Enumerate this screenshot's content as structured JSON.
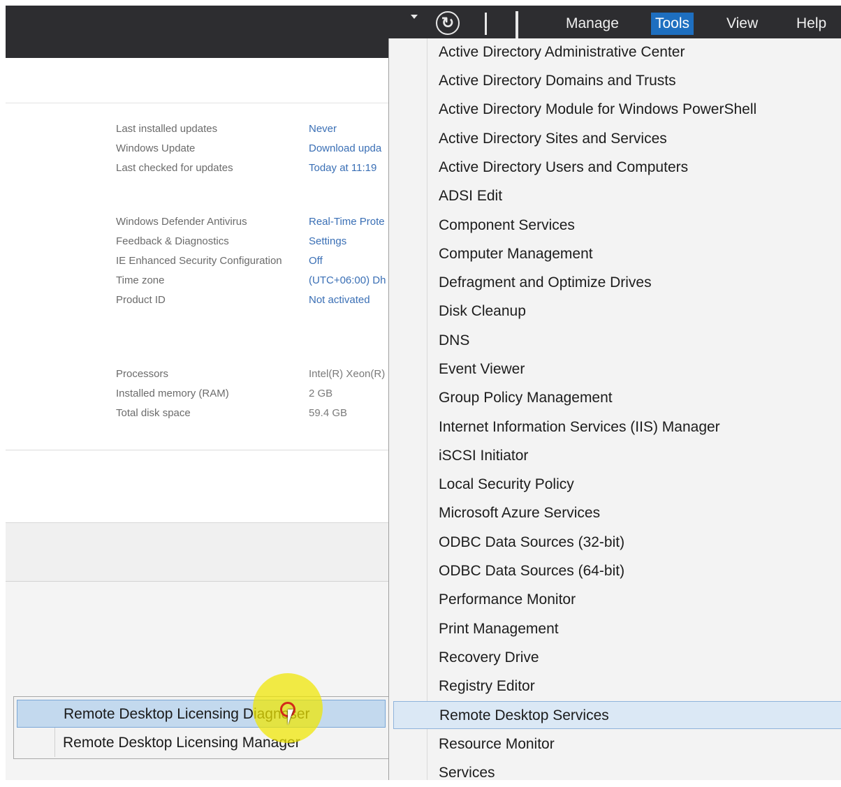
{
  "toolbar": {
    "menus": [
      "Manage",
      "Tools",
      "View",
      "Help"
    ],
    "active_menu": "Tools",
    "icons": [
      "dropdown-arrow-icon",
      "refresh-icon",
      "separator",
      "flag-icon"
    ]
  },
  "properties": {
    "group1": [
      {
        "label": "Last installed updates",
        "value": "Never"
      },
      {
        "label": "Windows Update",
        "value": "Download upda"
      },
      {
        "label": "Last checked for updates",
        "value": "Today at 11:19"
      }
    ],
    "group2": [
      {
        "label": "Windows Defender Antivirus",
        "value": "Real-Time Prote"
      },
      {
        "label": "Feedback & Diagnostics",
        "value": "Settings"
      },
      {
        "label": "IE Enhanced Security Configuration",
        "value": "Off"
      },
      {
        "label": "Time zone",
        "value": "(UTC+06:00) Dh"
      },
      {
        "label": "Product ID",
        "value": "Not activated"
      }
    ],
    "group3": [
      {
        "label": "Processors",
        "value": "Intel(R) Xeon(R)"
      },
      {
        "label": "Installed memory (RAM)",
        "value": "2 GB"
      },
      {
        "label": "Total disk space",
        "value": "59.4 GB"
      }
    ]
  },
  "tools_menu": {
    "items": [
      "Active Directory Administrative Center",
      "Active Directory Domains and Trusts",
      "Active Directory Module for Windows PowerShell",
      "Active Directory Sites and Services",
      "Active Directory Users and Computers",
      "ADSI Edit",
      "Component Services",
      "Computer Management",
      "Defragment and Optimize Drives",
      "Disk Cleanup",
      "DNS",
      "Event Viewer",
      "Group Policy Management",
      "Internet Information Services (IIS) Manager",
      "iSCSI Initiator",
      "Local Security Policy",
      "Microsoft Azure Services",
      "ODBC Data Sources (32-bit)",
      "ODBC Data Sources (64-bit)",
      "Performance Monitor",
      "Print Management",
      "Recovery Drive",
      "Registry Editor",
      "Remote Desktop Services",
      "Resource Monitor",
      "Services"
    ],
    "highlighted": "Remote Desktop Services"
  },
  "submenu": {
    "items": [
      "Remote Desktop Licensing Diagnoser",
      "Remote Desktop Licensing Manager"
    ],
    "highlighted": "Remote Desktop Licensing Diagnoser"
  },
  "colors": {
    "toolbar_bg": "#2d2d30",
    "active_menu_bg": "#1e6fc0",
    "link_value": "#3a6fb5",
    "menu_bg": "#f3f3f3",
    "highlight_bg": "#c3d9ee",
    "cursor_halo": "#f0e600"
  }
}
